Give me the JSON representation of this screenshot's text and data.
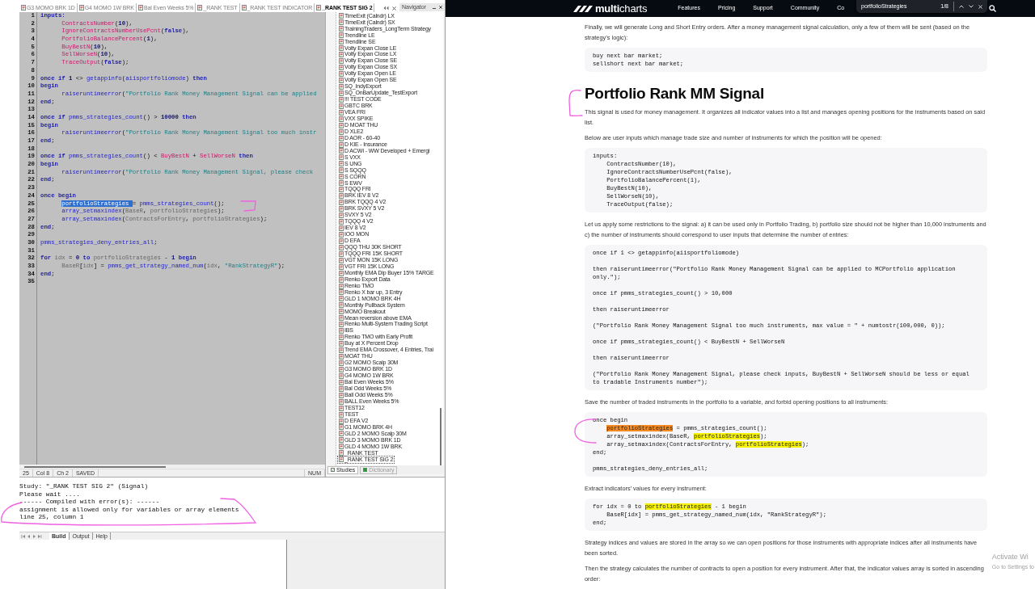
{
  "editor": {
    "tabs": [
      {
        "label": "G3 MOMO BRK 1D",
        "selected": false
      },
      {
        "label": "G4 MOMO 1W BRK",
        "selected": false
      },
      {
        "label": "Bal Even Weeks 5%",
        "selected": false
      },
      {
        "label": "_RANK TEST",
        "selected": false
      },
      {
        "label": "_RANK TEST INDICATOR",
        "selected": false
      },
      {
        "label": "_RANK TEST SIG 2",
        "selected": true
      }
    ],
    "code_lines": [
      {
        "number": "1",
        "segments": [
          {
            "text": "inputs:",
            "kind": "keyword"
          }
        ]
      },
      {
        "number": "2",
        "indented": true,
        "segments": [
          {
            "text": "ContractsNumber",
            "kind": "input"
          },
          {
            "text": "(",
            "kind": "plain"
          },
          {
            "text": "10",
            "kind": "number"
          },
          {
            "text": "),",
            "kind": "plain"
          }
        ]
      },
      {
        "number": "3",
        "indented": true,
        "segments": [
          {
            "text": "IgnoreContractsNumberUsePcnt",
            "kind": "input"
          },
          {
            "text": "(",
            "kind": "plain"
          },
          {
            "text": "false",
            "kind": "keyword"
          },
          {
            "text": "),",
            "kind": "plain"
          }
        ]
      },
      {
        "number": "4",
        "indented": true,
        "segments": [
          {
            "text": "PortfolioBalancePercent",
            "kind": "input"
          },
          {
            "text": "(",
            "kind": "plain"
          },
          {
            "text": "1",
            "kind": "number"
          },
          {
            "text": "),",
            "kind": "plain"
          }
        ]
      },
      {
        "number": "5",
        "indented": true,
        "segments": [
          {
            "text": "BuyBestN",
            "kind": "input"
          },
          {
            "text": "(",
            "kind": "plain"
          },
          {
            "text": "10",
            "kind": "number"
          },
          {
            "text": "),",
            "kind": "plain"
          }
        ]
      },
      {
        "number": "6",
        "indented": true,
        "segments": [
          {
            "text": "SellWorseN",
            "kind": "input"
          },
          {
            "text": "(",
            "kind": "plain"
          },
          {
            "text": "10",
            "kind": "number"
          },
          {
            "text": "),",
            "kind": "plain"
          }
        ]
      },
      {
        "number": "7",
        "indented": true,
        "segments": [
          {
            "text": "TraceOutput",
            "kind": "input"
          },
          {
            "text": "(",
            "kind": "plain"
          },
          {
            "text": "false",
            "kind": "keyword"
          },
          {
            "text": ");",
            "kind": "plain"
          }
        ]
      },
      {
        "number": "8"
      },
      {
        "number": "9",
        "segments": [
          {
            "text": "once if ",
            "kind": "keyword"
          },
          {
            "text": "1",
            "kind": "number"
          },
          {
            "text": " <> ",
            "kind": "plain"
          },
          {
            "text": "getappinfo",
            "kind": "function"
          },
          {
            "text": "(",
            "kind": "plain"
          },
          {
            "text": "aiisportfoliomode",
            "kind": "function"
          },
          {
            "text": ") ",
            "kind": "plain"
          },
          {
            "text": "then",
            "kind": "keyword"
          }
        ]
      },
      {
        "number": "10",
        "segments": [
          {
            "text": "begin",
            "kind": "keyword"
          }
        ]
      },
      {
        "number": "11",
        "indented": true,
        "segments": [
          {
            "text": "raiseruntimeerror",
            "kind": "function"
          },
          {
            "text": "(",
            "kind": "plain"
          },
          {
            "text": "\"Portfolio Rank Money Management Signal can be applied",
            "kind": "string"
          }
        ]
      },
      {
        "number": "12",
        "segments": [
          {
            "text": "end",
            "kind": "keyword"
          },
          {
            "text": ";",
            "kind": "plain"
          }
        ]
      },
      {
        "number": "13"
      },
      {
        "number": "14",
        "segments": [
          {
            "text": "once if ",
            "kind": "keyword"
          },
          {
            "text": "pmms_strategies_count",
            "kind": "function"
          },
          {
            "text": "() > ",
            "kind": "plain"
          },
          {
            "text": "10000",
            "kind": "number"
          },
          {
            "text": " then",
            "kind": "keyword"
          }
        ]
      },
      {
        "number": "15",
        "segments": [
          {
            "text": "begin",
            "kind": "keyword"
          }
        ]
      },
      {
        "number": "16",
        "indented": true,
        "segments": [
          {
            "text": "raiseruntimeerror",
            "kind": "function"
          },
          {
            "text": "(",
            "kind": "plain"
          },
          {
            "text": "\"Portfolio Rank Money Management Signal too much instr",
            "kind": "string"
          }
        ]
      },
      {
        "number": "17",
        "segments": [
          {
            "text": "end",
            "kind": "keyword"
          },
          {
            "text": ";",
            "kind": "plain"
          }
        ]
      },
      {
        "number": "18"
      },
      {
        "number": "19",
        "segments": [
          {
            "text": "once if ",
            "kind": "keyword"
          },
          {
            "text": "pmms_strategies_count",
            "kind": "function"
          },
          {
            "text": "() < ",
            "kind": "plain"
          },
          {
            "text": "BuyBestN",
            "kind": "input"
          },
          {
            "text": " + ",
            "kind": "plain"
          },
          {
            "text": "SellWorseN",
            "kind": "input"
          },
          {
            "text": " then",
            "kind": "keyword"
          }
        ]
      },
      {
        "number": "20",
        "segments": [
          {
            "text": "begin",
            "kind": "keyword"
          }
        ]
      },
      {
        "number": "21",
        "indented": true,
        "segments": [
          {
            "text": "raiseruntimeerror",
            "kind": "function"
          },
          {
            "text": "(",
            "kind": "plain"
          },
          {
            "text": "\"Portfolio Rank Money Management Signal, please check",
            "kind": "string"
          }
        ]
      },
      {
        "number": "22",
        "segments": [
          {
            "text": "end",
            "kind": "keyword"
          },
          {
            "text": ";",
            "kind": "plain"
          }
        ]
      },
      {
        "number": "23"
      },
      {
        "number": "24",
        "segments": [
          {
            "text": "once begin",
            "kind": "keyword"
          }
        ]
      },
      {
        "number": "25",
        "indented": true,
        "segments": [
          {
            "text": "portfolioStrategies ",
            "kind": "selected"
          },
          {
            "text": "= ",
            "kind": "plain"
          },
          {
            "text": "pmms_strategies_count",
            "kind": "function"
          },
          {
            "text": "();",
            "kind": "plain"
          }
        ]
      },
      {
        "number": "26",
        "indented": true,
        "segments": [
          {
            "text": "array_setmaxindex",
            "kind": "function"
          },
          {
            "text": "(",
            "kind": "plain"
          },
          {
            "text": "BaseR",
            "kind": "variable"
          },
          {
            "text": ", ",
            "kind": "plain"
          },
          {
            "text": "portfolioStrategies",
            "kind": "variable"
          },
          {
            "text": ");",
            "kind": "plain"
          }
        ]
      },
      {
        "number": "27",
        "indented": true,
        "segments": [
          {
            "text": "array_setmaxindex",
            "kind": "function"
          },
          {
            "text": "(",
            "kind": "plain"
          },
          {
            "text": "ContractsForEntry",
            "kind": "variable"
          },
          {
            "text": ", ",
            "kind": "plain"
          },
          {
            "text": "portfolioStrategies",
            "kind": "variable"
          },
          {
            "text": ");",
            "kind": "plain"
          }
        ]
      },
      {
        "number": "28",
        "segments": [
          {
            "text": "end",
            "kind": "keyword"
          },
          {
            "text": ";",
            "kind": "plain"
          }
        ]
      },
      {
        "number": "29"
      },
      {
        "number": "30",
        "segments": [
          {
            "text": "pmms_strategies_deny_entries_all",
            "kind": "function"
          },
          {
            "text": ";",
            "kind": "plain"
          }
        ]
      },
      {
        "number": "31"
      },
      {
        "number": "32",
        "segments": [
          {
            "text": "for ",
            "kind": "keyword"
          },
          {
            "text": "idx",
            "kind": "variable"
          },
          {
            "text": " = ",
            "kind": "plain"
          },
          {
            "text": "0",
            "kind": "number"
          },
          {
            "text": " to ",
            "kind": "keyword"
          },
          {
            "text": "portfolioStrategies",
            "kind": "variable"
          },
          {
            "text": " - ",
            "kind": "plain"
          },
          {
            "text": "1",
            "kind": "number"
          },
          {
            "text": " begin",
            "kind": "keyword"
          }
        ]
      },
      {
        "number": "33",
        "indented": true,
        "segments": [
          {
            "text": "BaseR",
            "kind": "variable"
          },
          {
            "text": "[",
            "kind": "plain"
          },
          {
            "text": "idx",
            "kind": "variable"
          },
          {
            "text": "] = ",
            "kind": "plain"
          },
          {
            "text": "pmms_get_strategy_named_num",
            "kind": "function"
          },
          {
            "text": "(",
            "kind": "plain"
          },
          {
            "text": "idx",
            "kind": "variable"
          },
          {
            "text": ", ",
            "kind": "plain"
          },
          {
            "text": "\"RankStrategyR\"",
            "kind": "string"
          },
          {
            "text": ");",
            "kind": "plain"
          }
        ]
      },
      {
        "number": "34",
        "segments": [
          {
            "text": "end",
            "kind": "keyword"
          },
          {
            "text": ";",
            "kind": "plain"
          }
        ]
      },
      {
        "number": "35"
      }
    ],
    "status_bar": [
      "25",
      "Col 8",
      "Ch 2",
      "SAVED",
      "NUM"
    ]
  },
  "navigator": {
    "title": "Navigator",
    "items": [
      {
        "label": "TimeExit (Calndr) LX",
        "selected": false
      },
      {
        "label": "TimeExit (Calndr) SX",
        "selected": false
      },
      {
        "label": "TrainingTraders_LongTerm Strategy",
        "selected": false
      },
      {
        "label": "Trendline LE",
        "selected": false
      },
      {
        "label": "Trendline SE",
        "selected": false
      },
      {
        "label": "Volty Expan Close LE",
        "selected": false
      },
      {
        "label": "Volty Expan Close LX",
        "selected": false
      },
      {
        "label": "Volty Expan Close SE",
        "selected": false
      },
      {
        "label": "Volty Expan Close SX",
        "selected": false
      },
      {
        "label": "Volty Expan Open LE",
        "selected": false
      },
      {
        "label": "Volty Expan Open SE",
        "selected": false
      },
      {
        "label": "SQ_IndyExport",
        "selected": false
      },
      {
        "label": "SQ_OnBarUpdate_TestExport",
        "selected": false
      },
      {
        "label": "!!! TEST CODE",
        "selected": false
      },
      {
        "label": "GBTC BRK",
        "selected": false
      },
      {
        "label": "VEA FRI",
        "selected": false
      },
      {
        "label": "VXX SPIKE",
        "selected": false
      },
      {
        "label": "D MOAT THU",
        "selected": false
      },
      {
        "label": "D XLE2",
        "selected": false
      },
      {
        "label": "D AOR - 60-40",
        "selected": false
      },
      {
        "label": "D KIE - Insurance",
        "selected": false
      },
      {
        "label": "D ACWI - WW Developed + Emergi",
        "selected": false
      },
      {
        "label": "S VXX",
        "selected": false
      },
      {
        "label": "S UNG",
        "selected": false
      },
      {
        "label": "S SQQQ",
        "selected": false
      },
      {
        "label": "S CORN",
        "selected": false
      },
      {
        "label": "S EWV",
        "selected": false
      },
      {
        "label": "TQQQ FRI",
        "selected": false
      },
      {
        "label": "BRK IEV 8 V2",
        "selected": false
      },
      {
        "label": "BRK TQQQ 4 V2",
        "selected": false
      },
      {
        "label": "BRK SVXY 5 V2",
        "selected": false
      },
      {
        "label": "SVXY 5 V2",
        "selected": false
      },
      {
        "label": "TQQQ 4 V2",
        "selected": false
      },
      {
        "label": "IEV 8 V2",
        "selected": false
      },
      {
        "label": "IOO MON",
        "selected": false
      },
      {
        "label": "D EFA",
        "selected": false
      },
      {
        "label": "QQQ THU 30K SHORT",
        "selected": false
      },
      {
        "label": "TQQQ FRI 15K SHORT",
        "selected": false
      },
      {
        "label": "VGT MON 15K LONG",
        "selected": false
      },
      {
        "label": "VGT FRI 15K LONG",
        "selected": false
      },
      {
        "label": "Monthly EMA Dip Buyer 15% TARGE",
        "selected": false
      },
      {
        "label": "Renko Export Data",
        "selected": false
      },
      {
        "label": "Renko TMO",
        "selected": false
      },
      {
        "label": "Renko X bar up, 3 Entry",
        "selected": false
      },
      {
        "label": "GLD 1 MOMO BRK 4H",
        "selected": false
      },
      {
        "label": "Monthly Pullback System",
        "selected": false
      },
      {
        "label": "MOMO Breakout",
        "selected": false
      },
      {
        "label": "Mean reversion above EMA",
        "selected": false
      },
      {
        "label": "Renko Multi-System Trading Script",
        "selected": false
      },
      {
        "label": "IBS",
        "selected": false
      },
      {
        "label": "Renko TMO with Early Profit",
        "selected": false
      },
      {
        "label": "Buy at X Percent Drop",
        "selected": false
      },
      {
        "label": "Trend EMA Crossover, 4 Entries, Trai",
        "selected": false
      },
      {
        "label": "MOAT THU",
        "selected": false
      },
      {
        "label": "G2 MOMO Scalp 30M",
        "selected": false
      },
      {
        "label": "G3 MOMO BRK 1D",
        "selected": false
      },
      {
        "label": "G4 MOMO 1W BRK",
        "selected": false
      },
      {
        "label": "Bal Even Weeks 5%",
        "selected": false
      },
      {
        "label": "Bal Odd Weeks 5%",
        "selected": false
      },
      {
        "label": "Ball Odd Weeks 5%",
        "selected": false
      },
      {
        "label": "BALL Even Weeks 5%",
        "selected": false
      },
      {
        "label": "TEST12",
        "selected": false
      },
      {
        "label": "TEST",
        "selected": false
      },
      {
        "label": "D EFA V2",
        "selected": false
      },
      {
        "label": "G1 MOMO BRK 4H",
        "selected": false
      },
      {
        "label": "GLD 2 MOMO Scalp 30M",
        "selected": false
      },
      {
        "label": "GLD 3 MOMO BRK 1D",
        "selected": false
      },
      {
        "label": "GLD 4 MOMO 1W BRK",
        "selected": false
      },
      {
        "label": "_RANK TEST",
        "selected": false
      },
      {
        "label": "_RANK TEST SIG 2",
        "selected": true
      }
    ],
    "tabs": [
      {
        "label": "Studies",
        "selected": true
      },
      {
        "label": "Dictionary",
        "selected": false
      }
    ]
  },
  "output": {
    "lines": [
      "Study: \"_RANK TEST SIG 2\" (Signal)",
      "Please wait ....",
      "------ Compiled with error(s): ------",
      "assignment is allowed only for variables or array elements",
      "line 25, column 1"
    ],
    "tabs": [
      {
        "label": "Build",
        "selected": true
      },
      {
        "label": "Output",
        "selected": false
      },
      {
        "label": "Help",
        "selected": false
      }
    ]
  },
  "browser": {
    "logo": "**multi**charts",
    "nav": [
      "Features",
      "Pricing",
      "Support",
      "Community",
      "Co"
    ],
    "find_bar": {
      "query": "portfolioStrategies",
      "count": "1/8"
    },
    "article": [
      {
        "kind": "paragraph",
        "text": "Finally, we will generate Long and Short Entry orders. After a money management signal calculation, only a few of them will be sent (based on the strategy’s logic):"
      },
      {
        "kind": "code",
        "paragraphs": [
          [
            [
              {
                "text": "buy next bar market;",
                "kind": "plain"
              }
            ],
            [
              {
                "text": "sellshort next bar market;",
                "kind": "plain"
              }
            ]
          ]
        ]
      },
      {
        "kind": "heading",
        "text": "Portfolio Rank MM Signal"
      },
      {
        "kind": "paragraph",
        "text": "This signal is used for money management. It organizes all indicator values into a list and manages opening positions for the instruments based on said list."
      },
      {
        "kind": "paragraph",
        "text": "Below are user inputs which manage trade size and number of instruments for which the position will be opened:"
      },
      {
        "kind": "code",
        "paragraphs": [
          [
            [
              {
                "text": "inputs:",
                "kind": "plain"
              }
            ],
            [
              {
                "text": "    ContractsNumber(10),",
                "kind": "plain"
              }
            ],
            [
              {
                "text": "    IgnoreContractsNumberUsePcnt(false),",
                "kind": "plain"
              }
            ],
            [
              {
                "text": "    PortfolioBalancePercent(1),",
                "kind": "plain"
              }
            ],
            [
              {
                "text": "    BuyBestN(10),",
                "kind": "plain"
              }
            ],
            [
              {
                "text": "    SellWorseN(10),",
                "kind": "plain"
              }
            ],
            [
              {
                "text": "    TraceOutput(false);",
                "kind": "plain"
              }
            ]
          ]
        ]
      },
      {
        "kind": "paragraph",
        "text": "Let us apply some restrictions to the signal: a) it can be used only in Portfolio Trading, b) portfolio size should not be higher than 10,000 instruments and c) the number of instruments should correspond to user inputs that determine the number of entries:"
      },
      {
        "kind": "code",
        "paragraphs": [
          [
            [
              {
                "text": "once if 1 <> getappinfo(aiisportfoliomode)",
                "kind": "plain"
              }
            ]
          ],
          [
            [
              {
                "text": "then raiseruntimeerror(\"Portfolio Rank Money Management Signal can be applied to MCPortfolio application",
                "kind": "plain"
              }
            ],
            [
              {
                "text": "only.\");",
                "kind": "plain"
              }
            ]
          ],
          [
            [
              {
                "text": "once if pmms_strategies_count() > 10,000",
                "kind": "plain"
              }
            ]
          ],
          [
            [
              {
                "text": "then raiseruntimeerror",
                "kind": "plain"
              }
            ]
          ],
          [
            [
              {
                "text": "(\"Portfolio Rank Money Management Signal too much instruments, max value = \" + numtostr(100,000, 0));",
                "kind": "plain"
              }
            ]
          ],
          [
            [
              {
                "text": "once if pmms_strategies_count() < BuyBestN + SellWorseN",
                "kind": "plain"
              }
            ]
          ],
          [
            [
              {
                "text": "then raiseruntimeerror",
                "kind": "plain"
              }
            ]
          ],
          [
            [
              {
                "text": "(\"Portfolio Rank Money Management Signal, please check inputs, BuyBestN + SellWorseN should be less or equal",
                "kind": "plain"
              }
            ],
            [
              {
                "text": "to tradable Instruments number\");",
                "kind": "plain"
              }
            ]
          ]
        ]
      },
      {
        "kind": "paragraph",
        "text": "Save the number of traded instruments in the portfolio to a variable, and forbid opening positions to all instruments:"
      },
      {
        "kind": "code",
        "paragraphs": [
          [
            [
              {
                "text": "once begin",
                "kind": "plain"
              }
            ],
            [
              {
                "text": "portfolioStrategies",
                "kind": "current",
                "indented": true
              },
              {
                "text": " = pmms_strategies_count();",
                "kind": "plain"
              }
            ],
            [
              {
                "text": "    array_setmaxindex(BaseR, ",
                "kind": "plain"
              },
              {
                "text": "portfolioStrategies",
                "kind": "match"
              },
              {
                "text": ");",
                "kind": "plain"
              }
            ],
            [
              {
                "text": "    array_setmaxindex(ContractsForEntry, ",
                "kind": "plain"
              },
              {
                "text": "portfolioStrategies",
                "kind": "match"
              },
              {
                "text": ");",
                "kind": "plain"
              }
            ],
            [
              {
                "text": "end;",
                "kind": "plain"
              }
            ]
          ],
          [
            [
              {
                "text": "pmms_strategies_deny_entries_all;",
                "kind": "plain"
              }
            ]
          ]
        ]
      },
      {
        "kind": "paragraph",
        "text": "Extract indicators’ values for every instrument:"
      },
      {
        "kind": "code",
        "paragraphs": [
          [
            [
              {
                "text": "for idx = 0 to ",
                "kind": "plain"
              },
              {
                "text": "portfolioStrategies",
                "kind": "match"
              },
              {
                "text": " - 1 begin",
                "kind": "plain"
              }
            ],
            [
              {
                "text": "    BaseR[idx] = pmms_get_strategy_named_num(idx, \"RankStrategyR\");",
                "kind": "plain"
              }
            ],
            [
              {
                "text": "end;",
                "kind": "plain"
              }
            ]
          ]
        ]
      },
      {
        "kind": "paragraph",
        "text": "Strategy indices and values are stored in the array so we can open positions for those instruments with appropriate indices after all instruments have been sorted."
      },
      {
        "kind": "paragraph",
        "text": "Then the strategy calculates the number of contracts to open a position for every instrument. After that, the indicator values array is sorted in ascending order:"
      }
    ]
  },
  "system_notice": [
    "Activate Wi",
    "Go to Settings to"
  ]
}
